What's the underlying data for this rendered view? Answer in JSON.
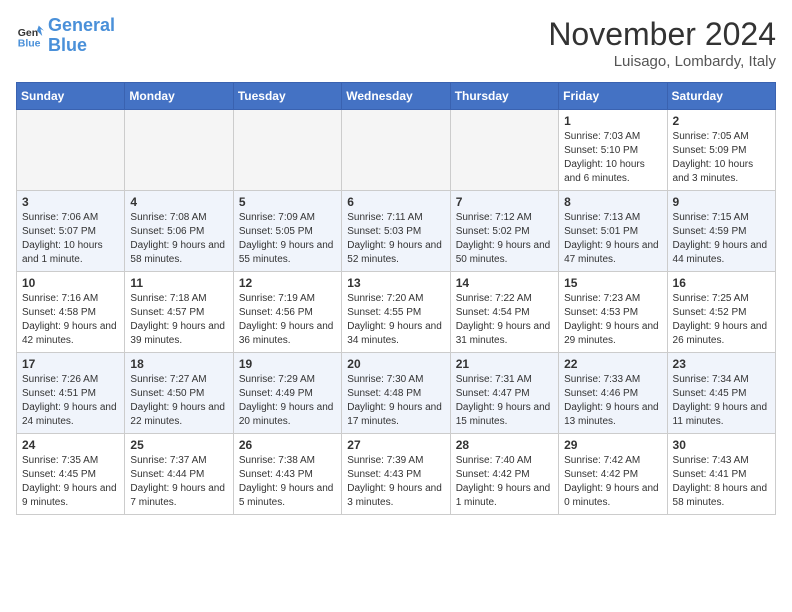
{
  "logo": {
    "line1": "General",
    "line2": "Blue"
  },
  "title": "November 2024",
  "location": "Luisago, Lombardy, Italy",
  "weekdays": [
    "Sunday",
    "Monday",
    "Tuesday",
    "Wednesday",
    "Thursday",
    "Friday",
    "Saturday"
  ],
  "weeks": [
    [
      {
        "day": "",
        "info": ""
      },
      {
        "day": "",
        "info": ""
      },
      {
        "day": "",
        "info": ""
      },
      {
        "day": "",
        "info": ""
      },
      {
        "day": "",
        "info": ""
      },
      {
        "day": "1",
        "info": "Sunrise: 7:03 AM\nSunset: 5:10 PM\nDaylight: 10 hours and 6 minutes."
      },
      {
        "day": "2",
        "info": "Sunrise: 7:05 AM\nSunset: 5:09 PM\nDaylight: 10 hours and 3 minutes."
      }
    ],
    [
      {
        "day": "3",
        "info": "Sunrise: 7:06 AM\nSunset: 5:07 PM\nDaylight: 10 hours and 1 minute."
      },
      {
        "day": "4",
        "info": "Sunrise: 7:08 AM\nSunset: 5:06 PM\nDaylight: 9 hours and 58 minutes."
      },
      {
        "day": "5",
        "info": "Sunrise: 7:09 AM\nSunset: 5:05 PM\nDaylight: 9 hours and 55 minutes."
      },
      {
        "day": "6",
        "info": "Sunrise: 7:11 AM\nSunset: 5:03 PM\nDaylight: 9 hours and 52 minutes."
      },
      {
        "day": "7",
        "info": "Sunrise: 7:12 AM\nSunset: 5:02 PM\nDaylight: 9 hours and 50 minutes."
      },
      {
        "day": "8",
        "info": "Sunrise: 7:13 AM\nSunset: 5:01 PM\nDaylight: 9 hours and 47 minutes."
      },
      {
        "day": "9",
        "info": "Sunrise: 7:15 AM\nSunset: 4:59 PM\nDaylight: 9 hours and 44 minutes."
      }
    ],
    [
      {
        "day": "10",
        "info": "Sunrise: 7:16 AM\nSunset: 4:58 PM\nDaylight: 9 hours and 42 minutes."
      },
      {
        "day": "11",
        "info": "Sunrise: 7:18 AM\nSunset: 4:57 PM\nDaylight: 9 hours and 39 minutes."
      },
      {
        "day": "12",
        "info": "Sunrise: 7:19 AM\nSunset: 4:56 PM\nDaylight: 9 hours and 36 minutes."
      },
      {
        "day": "13",
        "info": "Sunrise: 7:20 AM\nSunset: 4:55 PM\nDaylight: 9 hours and 34 minutes."
      },
      {
        "day": "14",
        "info": "Sunrise: 7:22 AM\nSunset: 4:54 PM\nDaylight: 9 hours and 31 minutes."
      },
      {
        "day": "15",
        "info": "Sunrise: 7:23 AM\nSunset: 4:53 PM\nDaylight: 9 hours and 29 minutes."
      },
      {
        "day": "16",
        "info": "Sunrise: 7:25 AM\nSunset: 4:52 PM\nDaylight: 9 hours and 26 minutes."
      }
    ],
    [
      {
        "day": "17",
        "info": "Sunrise: 7:26 AM\nSunset: 4:51 PM\nDaylight: 9 hours and 24 minutes."
      },
      {
        "day": "18",
        "info": "Sunrise: 7:27 AM\nSunset: 4:50 PM\nDaylight: 9 hours and 22 minutes."
      },
      {
        "day": "19",
        "info": "Sunrise: 7:29 AM\nSunset: 4:49 PM\nDaylight: 9 hours and 20 minutes."
      },
      {
        "day": "20",
        "info": "Sunrise: 7:30 AM\nSunset: 4:48 PM\nDaylight: 9 hours and 17 minutes."
      },
      {
        "day": "21",
        "info": "Sunrise: 7:31 AM\nSunset: 4:47 PM\nDaylight: 9 hours and 15 minutes."
      },
      {
        "day": "22",
        "info": "Sunrise: 7:33 AM\nSunset: 4:46 PM\nDaylight: 9 hours and 13 minutes."
      },
      {
        "day": "23",
        "info": "Sunrise: 7:34 AM\nSunset: 4:45 PM\nDaylight: 9 hours and 11 minutes."
      }
    ],
    [
      {
        "day": "24",
        "info": "Sunrise: 7:35 AM\nSunset: 4:45 PM\nDaylight: 9 hours and 9 minutes."
      },
      {
        "day": "25",
        "info": "Sunrise: 7:37 AM\nSunset: 4:44 PM\nDaylight: 9 hours and 7 minutes."
      },
      {
        "day": "26",
        "info": "Sunrise: 7:38 AM\nSunset: 4:43 PM\nDaylight: 9 hours and 5 minutes."
      },
      {
        "day": "27",
        "info": "Sunrise: 7:39 AM\nSunset: 4:43 PM\nDaylight: 9 hours and 3 minutes."
      },
      {
        "day": "28",
        "info": "Sunrise: 7:40 AM\nSunset: 4:42 PM\nDaylight: 9 hours and 1 minute."
      },
      {
        "day": "29",
        "info": "Sunrise: 7:42 AM\nSunset: 4:42 PM\nDaylight: 9 hours and 0 minutes."
      },
      {
        "day": "30",
        "info": "Sunrise: 7:43 AM\nSunset: 4:41 PM\nDaylight: 8 hours and 58 minutes."
      }
    ]
  ]
}
